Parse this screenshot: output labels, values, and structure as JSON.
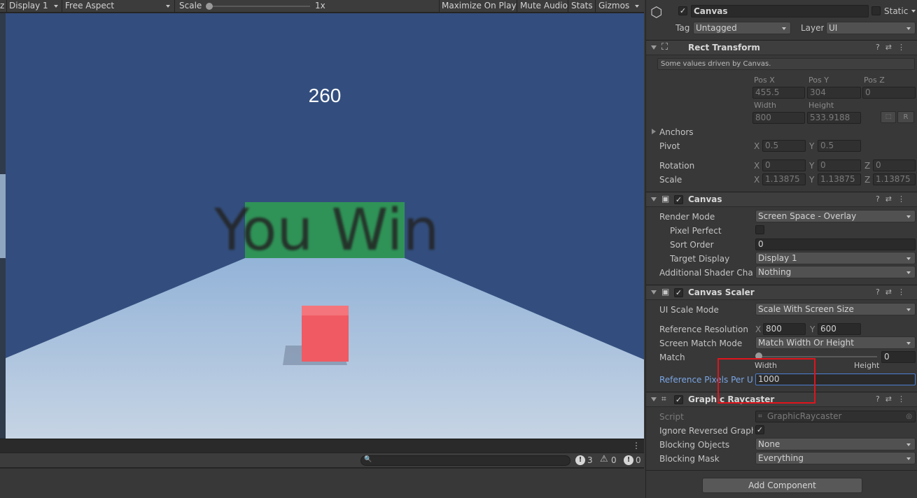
{
  "game_toolbar": {
    "display": "Display 1",
    "aspect": "Free Aspect",
    "scale_label": "Scale",
    "scale_value": "1x",
    "maximize": "Maximize On Play",
    "mute": "Mute Audio",
    "stats": "Stats",
    "gizmos": "Gizmos"
  },
  "game_view": {
    "score": "260",
    "win_text": "You Win"
  },
  "console": {
    "log_count": "3",
    "warn_count": "0",
    "error_count": "0"
  },
  "inspector": {
    "object_name": "Canvas",
    "static_label": "Static",
    "tag_label": "Tag",
    "tag_value": "Untagged",
    "layer_label": "Layer",
    "layer_value": "UI",
    "rect_transform": {
      "title": "Rect Transform",
      "info": "Some values driven by Canvas.",
      "pos_x_label": "Pos X",
      "pos_y_label": "Pos Y",
      "pos_z_label": "Pos Z",
      "pos_x": "455.5",
      "pos_y": "304",
      "pos_z": "0",
      "width_label": "Width",
      "height_label": "Height",
      "width": "800",
      "height": "533.9188",
      "r_button": "R",
      "anchors": "Anchors",
      "pivot": "Pivot",
      "pivot_x": "0.5",
      "pivot_y": "0.5",
      "rotation": "Rotation",
      "rot_x": "0",
      "rot_y": "0",
      "rot_z": "0",
      "scale": "Scale",
      "scale_x": "1.13875",
      "scale_y": "1.13875",
      "scale_z": "1.13875",
      "x": "X",
      "y": "Y",
      "z": "Z"
    },
    "canvas": {
      "title": "Canvas",
      "render_mode_label": "Render Mode",
      "render_mode": "Screen Space - Overlay",
      "pixel_perfect_label": "Pixel Perfect",
      "sort_order_label": "Sort Order",
      "sort_order": "0",
      "target_display_label": "Target Display",
      "target_display": "Display 1",
      "shader_label": "Additional Shader Chann",
      "shader": "Nothing"
    },
    "canvas_scaler": {
      "title": "Canvas Scaler",
      "ui_scale_label": "UI Scale Mode",
      "ui_scale": "Scale With Screen Size",
      "ref_res_label": "Reference Resolution",
      "ref_x": "800",
      "ref_y": "600",
      "match_mode_label": "Screen Match Mode",
      "match_mode": "Match Width Or Height",
      "match_label": "Match",
      "match_value": "0",
      "match_fraction": 0,
      "width_label": "Width",
      "height_label": "Height",
      "ref_ppu_label": "Reference Pixels Per Un",
      "ref_ppu": "1000"
    },
    "graphic_raycaster": {
      "title": "Graphic Raycaster",
      "script_label": "Script",
      "script": "GraphicRaycaster",
      "ignore_label": "Ignore Reversed Graphic",
      "blocking_objects_label": "Blocking Objects",
      "blocking_objects": "None",
      "blocking_mask_label": "Blocking Mask",
      "blocking_mask": "Everything"
    },
    "add_component": "Add Component"
  },
  "colors": {
    "sky": "#334e7e",
    "floor": "#a9c4de",
    "cube": "#f05a63",
    "panel": "#2fa050",
    "highlight": "#e0141c",
    "link_blue": "#7aa6e6"
  }
}
